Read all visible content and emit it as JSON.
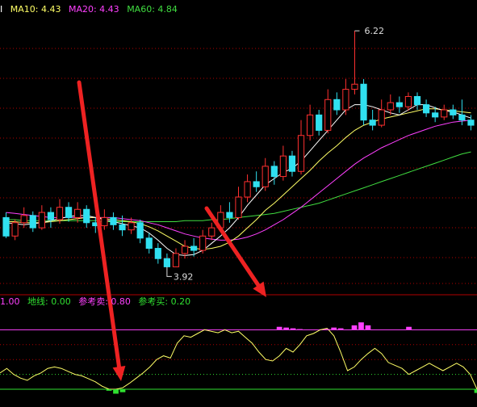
{
  "ma_legend": {
    "ma5_frag": "I",
    "ma10": "MA10: 4.43",
    "ma20": "MA20: 4.43",
    "ma60": "MA60: 4.84"
  },
  "ind_legend": {
    "line1": "1.00",
    "ground": "地线: 0.00",
    "ref_sell": "参考卖: 0.80",
    "ref_buy": "参考买: 0.20"
  },
  "annotations": {
    "high": "6.22",
    "low": "3.92"
  },
  "colors": {
    "up": "#ff3030",
    "down": "#30e0f0",
    "ma5": "#ffffff",
    "ma10": "#ffff66",
    "ma20": "#ff40ff",
    "ma60": "#40dd40",
    "grid": "#b00000",
    "arrow": "#ee2222",
    "osc": "#ffff66",
    "sell_line": "#ff40ff",
    "buy_line": "#30e030",
    "sell_bar": "#ff40ff",
    "buy_bar": "#30e030"
  },
  "chart_data": [
    {
      "type": "candlestick",
      "ylim": [
        3.75,
        6.3
      ],
      "candles": [
        [
          4.4,
          4.22,
          4.45,
          4.2
        ],
        [
          4.22,
          4.35,
          4.38,
          4.18
        ],
        [
          4.35,
          4.42,
          4.5,
          4.3
        ],
        [
          4.42,
          4.3,
          4.46,
          4.26
        ],
        [
          4.3,
          4.45,
          4.52,
          4.28
        ],
        [
          4.45,
          4.38,
          4.5,
          4.3
        ],
        [
          4.38,
          4.5,
          4.58,
          4.34
        ],
        [
          4.5,
          4.4,
          4.55,
          4.36
        ],
        [
          4.4,
          4.48,
          4.55,
          4.35
        ],
        [
          4.48,
          4.35,
          4.52,
          4.3
        ],
        [
          4.35,
          4.32,
          4.4,
          4.25
        ],
        [
          4.32,
          4.4,
          4.48,
          4.28
        ],
        [
          4.4,
          4.33,
          4.45,
          4.28
        ],
        [
          4.33,
          4.28,
          4.42,
          4.22
        ],
        [
          4.28,
          4.35,
          4.4,
          4.24
        ],
        [
          4.35,
          4.2,
          4.38,
          4.15
        ],
        [
          4.2,
          4.1,
          4.25,
          4.05
        ],
        [
          4.1,
          4.0,
          4.15,
          3.95
        ],
        [
          4.0,
          3.92,
          4.05,
          3.92
        ],
        [
          3.92,
          4.05,
          4.1,
          3.92
        ],
        [
          4.05,
          4.12,
          4.18,
          4.0
        ],
        [
          4.12,
          4.08,
          4.2,
          4.02
        ],
        [
          4.08,
          4.22,
          4.28,
          4.05
        ],
        [
          4.22,
          4.3,
          4.35,
          4.18
        ],
        [
          4.3,
          4.45,
          4.52,
          4.26
        ],
        [
          4.45,
          4.4,
          4.55,
          4.35
        ],
        [
          4.4,
          4.6,
          4.7,
          4.38
        ],
        [
          4.6,
          4.75,
          4.82,
          4.55
        ],
        [
          4.75,
          4.7,
          4.85,
          4.65
        ],
        [
          4.7,
          4.9,
          4.98,
          4.66
        ],
        [
          4.9,
          4.8,
          4.95,
          4.72
        ],
        [
          4.8,
          5.0,
          5.1,
          4.76
        ],
        [
          5.0,
          4.85,
          5.05,
          4.8
        ],
        [
          4.85,
          5.2,
          5.35,
          4.82
        ],
        [
          5.2,
          5.4,
          5.5,
          5.15
        ],
        [
          5.4,
          5.25,
          5.45,
          5.2
        ],
        [
          5.25,
          5.55,
          5.65,
          5.22
        ],
        [
          5.55,
          5.45,
          5.62,
          5.4
        ],
        [
          5.45,
          5.65,
          5.75,
          5.4
        ],
        [
          5.65,
          5.7,
          6.22,
          5.6
        ],
        [
          5.7,
          5.35,
          5.75,
          5.3
        ],
        [
          5.35,
          5.3,
          5.45,
          5.25
        ],
        [
          5.3,
          5.45,
          5.55,
          5.28
        ],
        [
          5.45,
          5.52,
          5.6,
          5.4
        ],
        [
          5.52,
          5.48,
          5.58,
          5.42
        ],
        [
          5.48,
          5.58,
          5.62,
          5.44
        ],
        [
          5.58,
          5.5,
          5.62,
          5.45
        ],
        [
          5.5,
          5.42,
          5.55,
          5.38
        ],
        [
          5.42,
          5.38,
          5.48,
          5.33
        ],
        [
          5.38,
          5.45,
          5.5,
          5.35
        ],
        [
          5.45,
          5.4,
          5.5,
          5.36
        ],
        [
          5.4,
          5.35,
          5.55,
          5.3
        ],
        [
          5.35,
          5.3,
          5.4,
          5.25
        ]
      ],
      "ma5": [
        4.35,
        4.34,
        4.33,
        4.34,
        4.35,
        4.37,
        4.39,
        4.41,
        4.42,
        4.42,
        4.4,
        4.38,
        4.36,
        4.34,
        4.32,
        4.3,
        4.25,
        4.18,
        4.1,
        4.04,
        4.03,
        4.04,
        4.08,
        4.15,
        4.22,
        4.3,
        4.4,
        4.52,
        4.62,
        4.72,
        4.78,
        4.84,
        4.88,
        4.95,
        5.05,
        5.15,
        5.25,
        5.35,
        5.45,
        5.5,
        5.5,
        5.48,
        5.45,
        5.42,
        5.4,
        5.45,
        5.5,
        5.5,
        5.47,
        5.44,
        5.43,
        5.4,
        5.37
      ],
      "ma10": [
        4.36,
        4.36,
        4.35,
        4.35,
        4.35,
        4.36,
        4.37,
        4.38,
        4.39,
        4.4,
        4.4,
        4.39,
        4.38,
        4.37,
        4.36,
        4.34,
        4.31,
        4.27,
        4.22,
        4.17,
        4.12,
        4.1,
        4.09,
        4.1,
        4.12,
        4.16,
        4.22,
        4.3,
        4.38,
        4.47,
        4.54,
        4.62,
        4.7,
        4.78,
        4.86,
        4.95,
        5.03,
        5.1,
        5.18,
        5.25,
        5.3,
        5.33,
        5.36,
        5.38,
        5.4,
        5.42,
        5.44,
        5.46,
        5.46,
        5.45,
        5.44,
        5.43,
        5.42
      ],
      "ma20": [
        4.45,
        4.44,
        4.43,
        4.42,
        4.41,
        4.4,
        4.4,
        4.4,
        4.4,
        4.4,
        4.4,
        4.4,
        4.4,
        4.39,
        4.38,
        4.37,
        4.35,
        4.33,
        4.3,
        4.27,
        4.24,
        4.22,
        4.2,
        4.19,
        4.18,
        4.18,
        4.19,
        4.21,
        4.24,
        4.28,
        4.33,
        4.38,
        4.44,
        4.5,
        4.57,
        4.64,
        4.71,
        4.78,
        4.85,
        4.92,
        4.98,
        5.03,
        5.08,
        5.12,
        5.16,
        5.2,
        5.23,
        5.26,
        5.29,
        5.31,
        5.33,
        5.34,
        5.35
      ],
      "ma60": [
        4.38,
        4.38,
        4.37,
        4.37,
        4.37,
        4.37,
        4.37,
        4.37,
        4.37,
        4.37,
        4.37,
        4.36,
        4.36,
        4.36,
        4.36,
        4.36,
        4.36,
        4.36,
        4.36,
        4.36,
        4.37,
        4.37,
        4.37,
        4.38,
        4.38,
        4.39,
        4.4,
        4.41,
        4.42,
        4.43,
        4.44,
        4.46,
        4.48,
        4.5,
        4.52,
        4.54,
        4.57,
        4.6,
        4.63,
        4.66,
        4.69,
        4.72,
        4.75,
        4.78,
        4.81,
        4.84,
        4.87,
        4.9,
        4.93,
        4.96,
        4.99,
        5.02,
        5.04
      ]
    },
    {
      "type": "line",
      "ylim": [
        0,
        1.0
      ],
      "levels": [
        0.8,
        0.2,
        0
      ],
      "osc": [
        0.22,
        0.28,
        0.2,
        0.15,
        0.12,
        0.18,
        0.22,
        0.28,
        0.3,
        0.28,
        0.24,
        0.2,
        0.18,
        0.14,
        0.1,
        0.04,
        0.0,
        0.0,
        0.02,
        0.08,
        0.15,
        0.22,
        0.3,
        0.4,
        0.45,
        0.42,
        0.62,
        0.72,
        0.7,
        0.75,
        0.8,
        0.78,
        0.76,
        0.8,
        0.76,
        0.78,
        0.7,
        0.62,
        0.5,
        0.4,
        0.38,
        0.45,
        0.55,
        0.5,
        0.6,
        0.72,
        0.75,
        0.8,
        0.82,
        0.72,
        0.5,
        0.25,
        0.3,
        0.4,
        0.48,
        0.55,
        0.48,
        0.36,
        0.32,
        0.28,
        0.2,
        0.25,
        0.3,
        0.35,
        0.3,
        0.25,
        0.3,
        0.35,
        0.3,
        0.2,
        0.0
      ],
      "sell_bars": [
        [
          41,
          0.84
        ],
        [
          42,
          0.83
        ],
        [
          43,
          0.82
        ],
        [
          44,
          0.81
        ],
        [
          48,
          0.81
        ],
        [
          49,
          0.83
        ],
        [
          50,
          0.82
        ],
        [
          52,
          0.86
        ],
        [
          53,
          0.9
        ],
        [
          54,
          0.86
        ],
        [
          60,
          0.84
        ]
      ],
      "buy_bars": [
        [
          16,
          -0.02
        ],
        [
          17,
          -0.06
        ],
        [
          18,
          -0.04
        ],
        [
          70,
          -0.05
        ]
      ]
    }
  ]
}
